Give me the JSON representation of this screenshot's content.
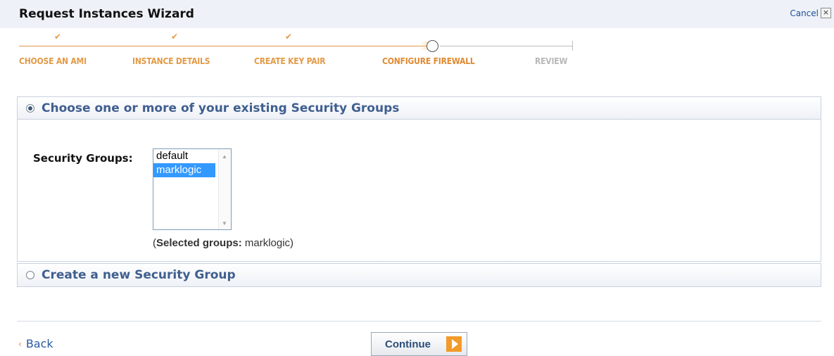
{
  "header": {
    "title": "Request Instances Wizard",
    "cancel_label": "Cancel",
    "cancel_icon": "close-icon"
  },
  "progress": {
    "steps": [
      {
        "label": "CHOOSE AN AMI",
        "state": "done"
      },
      {
        "label": "INSTANCE DETAILS",
        "state": "done"
      },
      {
        "label": "CREATE KEY PAIR",
        "state": "done"
      },
      {
        "label": "CONFIGURE FIREWALL",
        "state": "current"
      },
      {
        "label": "REVIEW",
        "state": "todo"
      }
    ],
    "check_glyph": "✔"
  },
  "existing_groups": {
    "heading": "Choose one or more of your existing Security Groups",
    "selected": true,
    "field_label": "Security Groups:",
    "options": [
      "default",
      "marklogic"
    ],
    "selected_option": "marklogic",
    "selected_note_prefix": "(",
    "selected_note_bold": "Selected groups:",
    "selected_note_value": " marklogic)"
  },
  "new_group": {
    "heading": "Create a new Security Group",
    "selected": false
  },
  "footer": {
    "back_glyph": "‹",
    "back_label": "Back",
    "continue_label": "Continue"
  },
  "colors": {
    "accent_orange": "#e08a32",
    "heading_blue": "#3f5f8f",
    "selection_blue": "#3399ff",
    "link_blue": "#2a5aa0"
  }
}
